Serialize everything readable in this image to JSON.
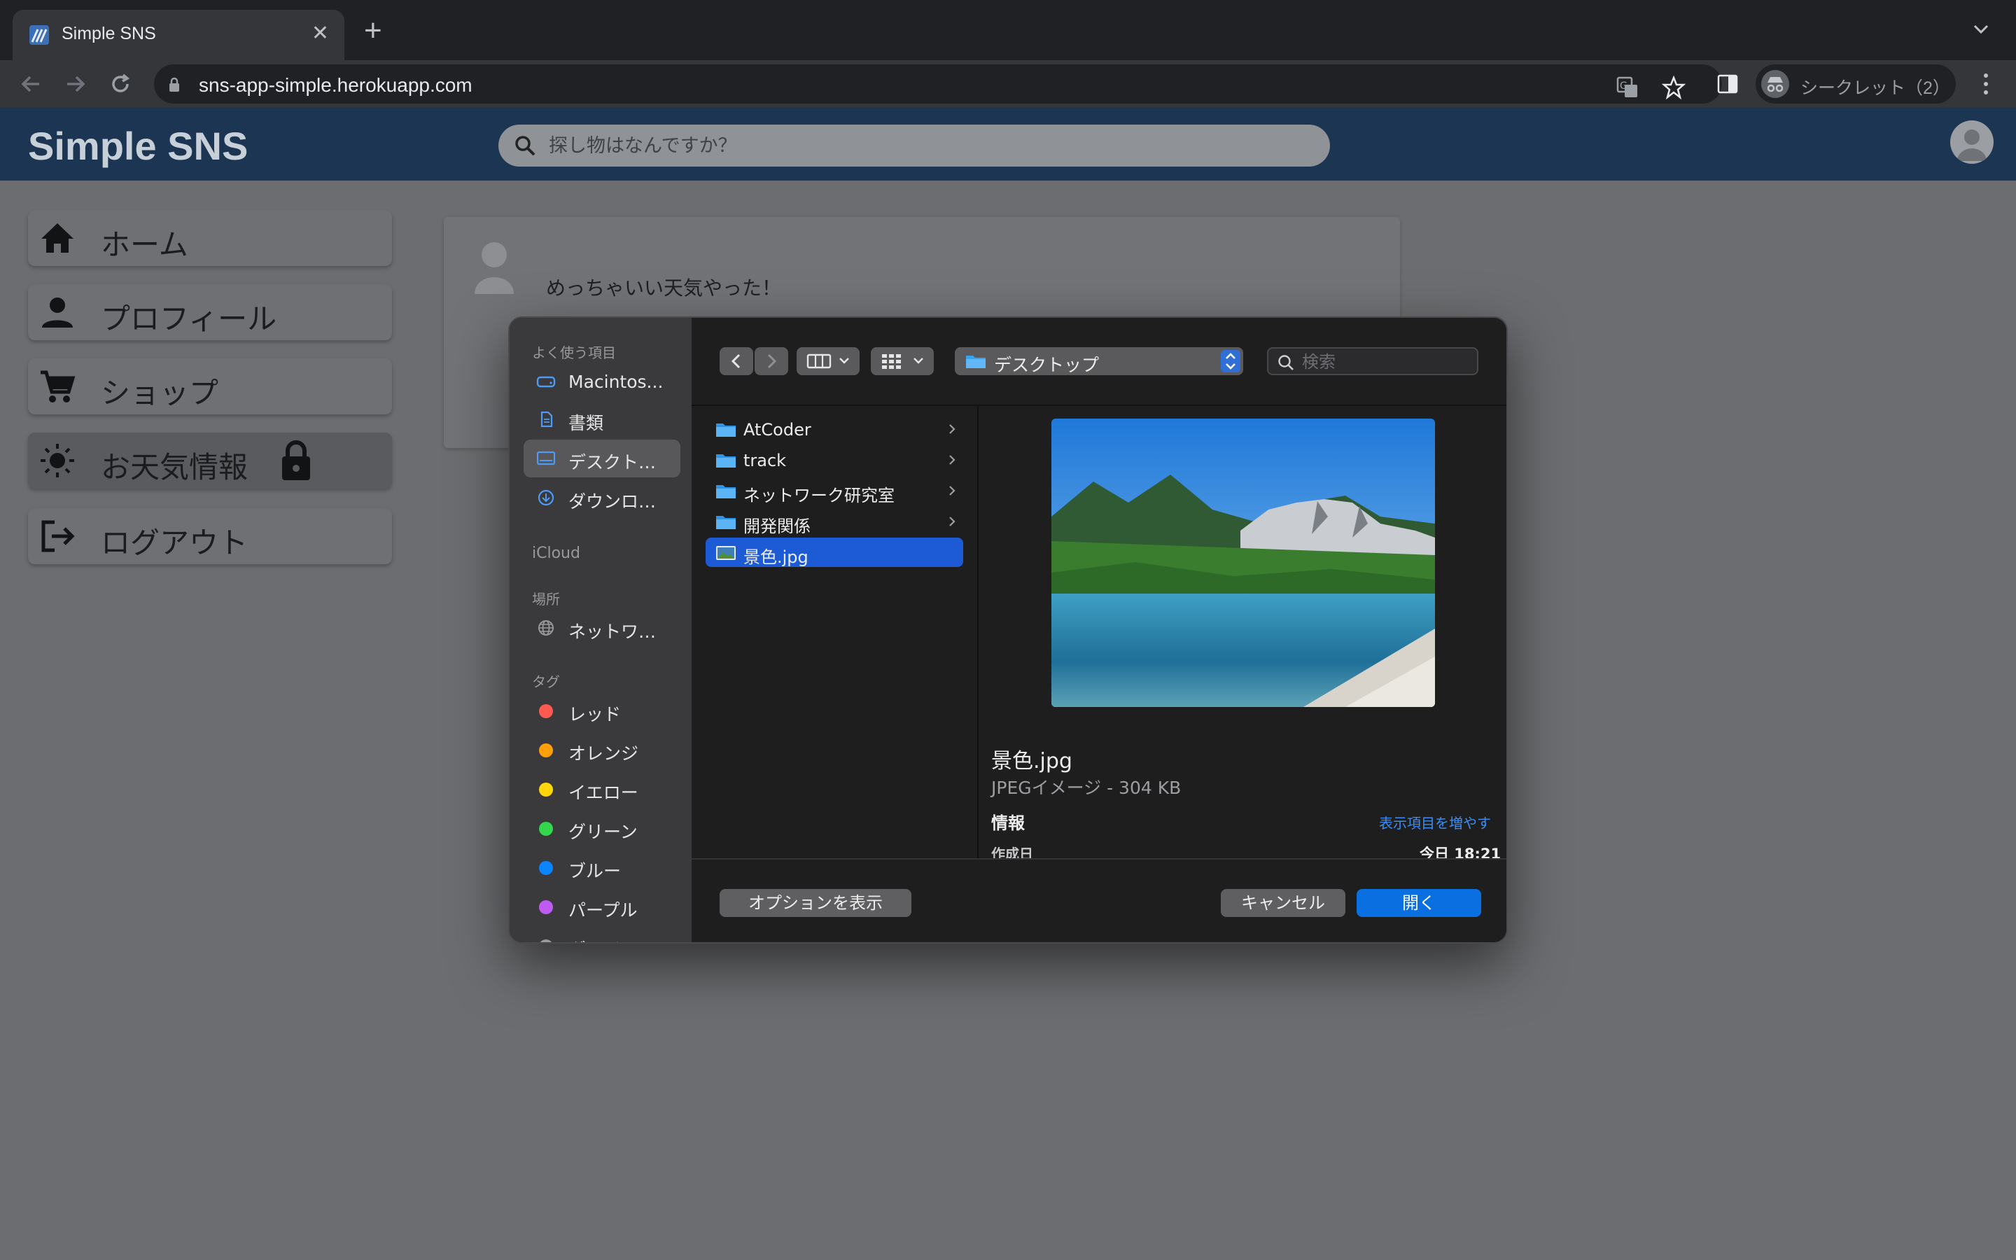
{
  "browser": {
    "tab_title": "Simple SNS",
    "url": "sns-app-simple.herokuapp.com",
    "profile_label": "シークレット（2）"
  },
  "app": {
    "brand": "Simple SNS",
    "search_placeholder": "探し物はなんですか？"
  },
  "sidebar_menu": [
    {
      "label": "ホーム",
      "icon": "home-icon"
    },
    {
      "label": "プロフィール",
      "icon": "person-icon"
    },
    {
      "label": "ショップ",
      "icon": "cart-icon"
    },
    {
      "label": "お天気情報",
      "icon": "sun-icon",
      "locked": true
    },
    {
      "label": "ログアウト",
      "icon": "logout-icon"
    }
  ],
  "post": {
    "text": "めっちゃいい天気やった！"
  },
  "dialog": {
    "sidebar": {
      "favorites_heading": "よく使う項目",
      "favorites": [
        {
          "label": "Macintos...",
          "icon": "disk-icon"
        },
        {
          "label": "書類",
          "icon": "document-icon"
        },
        {
          "label": "デスクト…",
          "icon": "desktop-icon",
          "selected": true
        },
        {
          "label": "ダウンロ…",
          "icon": "download-icon"
        }
      ],
      "icloud_heading": "iCloud",
      "locations_heading": "場所",
      "locations": [
        {
          "label": "ネットワ…",
          "icon": "network-globe-icon"
        }
      ],
      "tags_heading": "タグ",
      "tags": [
        {
          "label": "レッド",
          "color": "#ff5a52"
        },
        {
          "label": "オレンジ",
          "color": "#ff9f0a"
        },
        {
          "label": "イエロー",
          "color": "#ffd60a"
        },
        {
          "label": "グリーン",
          "color": "#32d74b"
        },
        {
          "label": "ブルー",
          "color": "#0a84ff"
        },
        {
          "label": "パープル",
          "color": "#bf5af2"
        },
        {
          "label": "グレイ",
          "color": "#98989d"
        }
      ]
    },
    "location_popup": "デスクトップ",
    "search_placeholder": "検索",
    "files": [
      {
        "name": "AtCoder",
        "type": "folder"
      },
      {
        "name": "track",
        "type": "folder"
      },
      {
        "name": "ネットワーク研究室",
        "type": "folder"
      },
      {
        "name": "開発関係",
        "type": "folder"
      },
      {
        "name": "景色.jpg",
        "type": "image",
        "selected": true
      }
    ],
    "preview": {
      "name": "景色.jpg",
      "kind": "JPEGイメージ - 304 KB",
      "info_heading": "情報",
      "more_link": "表示項目を増やす",
      "created_label": "作成日",
      "created_value": "今日 18:21"
    },
    "buttons": {
      "options": "オプションを表示",
      "cancel": "キャンセル",
      "open": "開く"
    }
  },
  "colors": {
    "accent": "#0a6fe0",
    "header": "#1c3552",
    "selection": "#1d5bd6"
  }
}
